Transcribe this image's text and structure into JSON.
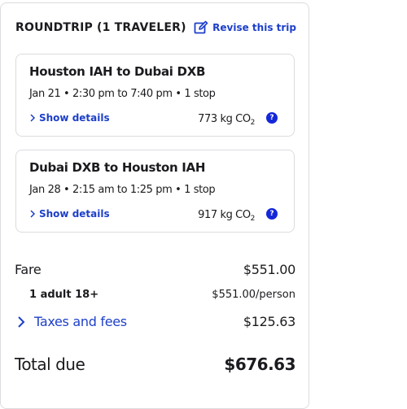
{
  "header": {
    "trip_type": "ROUNDTRIP (1 TRAVELER)",
    "revise_label": "Revise this trip",
    "revise_icon": "edit-icon"
  },
  "flights": [
    {
      "route": "Houston IAH to Dubai DXB",
      "schedule": "Jan 21 • 2:30 pm to 7:40 pm • 1 stop",
      "details_label": "Show details",
      "co2_value": "773 kg CO",
      "co2_sub": "2",
      "help_glyph": "?"
    },
    {
      "route": "Dubai DXB to Houston IAH",
      "schedule": "Jan 28 • 2:15 am to 1:25 pm • 1 stop",
      "details_label": "Show details",
      "co2_value": "917 kg CO",
      "co2_sub": "2",
      "help_glyph": "?"
    }
  ],
  "pricing": {
    "fare_label": "Fare",
    "fare_value": "$551.00",
    "adult_label": "1 adult 18+",
    "adult_value": "$551.00/person",
    "taxes_label": "Taxes and fees",
    "taxes_value": "$125.63",
    "total_label": "Total due",
    "total_value": "$676.63"
  },
  "colors": {
    "link": "#1d3fc9",
    "help_badge": "#1428d9",
    "border": "#dcdce0",
    "text": "#1b1b1f"
  }
}
